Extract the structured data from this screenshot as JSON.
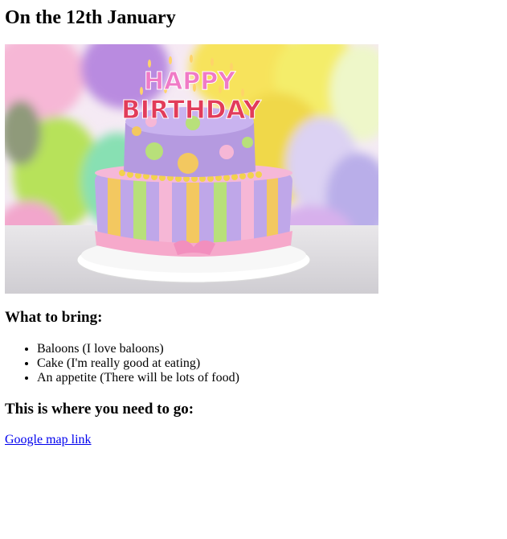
{
  "page": {
    "title": "On the 12th January"
  },
  "hero_image": {
    "topper_word_1": "HAPPY",
    "topper_word_2": "BIRTHDAY"
  },
  "bring_section": {
    "heading": "What to bring:",
    "items": [
      "Baloons (I love baloons)",
      "Cake (I'm really good at eating)",
      "An appetite (There will be lots of food)"
    ]
  },
  "location_section": {
    "heading": "This is where you need to go:",
    "link_label": "Google map link"
  },
  "colors": {
    "link": "#0000ee",
    "text": "#000000",
    "background": "#ffffff"
  }
}
